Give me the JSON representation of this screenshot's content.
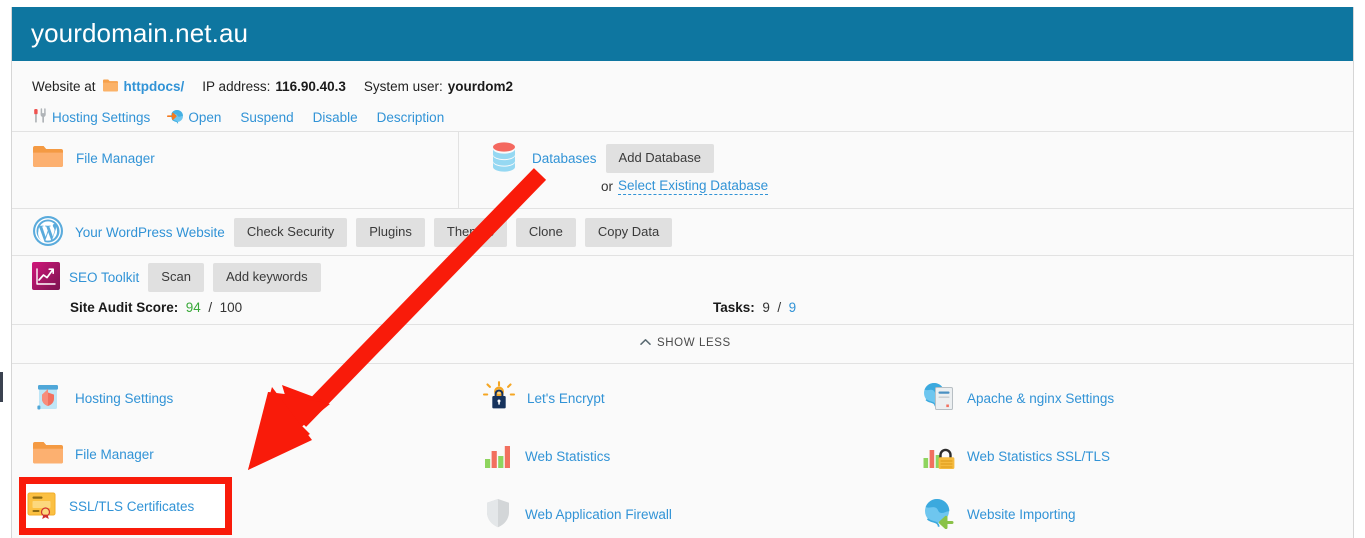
{
  "header": {
    "domain": "yourdomain.net.au",
    "bar_color": "#0e76a0"
  },
  "info": {
    "website_at_label": "Website at",
    "httpdocs_link": "httpdocs/",
    "ip_label": "IP address:",
    "ip_value": "116.90.40.3",
    "system_user_label": "System user:",
    "system_user_value": "yourdom2"
  },
  "actions": [
    {
      "label": "Hosting Settings",
      "icon": "tools-icon"
    },
    {
      "label": "Open",
      "icon": "globe-arrow-icon"
    },
    {
      "label": "Suspend",
      "icon": ""
    },
    {
      "label": "Disable",
      "icon": ""
    },
    {
      "label": "Description",
      "icon": ""
    }
  ],
  "file_manager_row": {
    "label": "File Manager",
    "icon": "folder-icon"
  },
  "databases_row": {
    "label": "Databases",
    "icon": "database-icon",
    "add_button": "Add Database",
    "or_text": "or",
    "select_existing_link": "Select Existing Database"
  },
  "wordpress_row": {
    "label": "Your WordPress Website",
    "icon": "wordpress-icon",
    "buttons": [
      "Check Security",
      "Plugins",
      "Themes",
      "Clone",
      "Copy Data"
    ]
  },
  "seo_row": {
    "label": "SEO Toolkit",
    "icon": "seo-chart-icon",
    "buttons": [
      "Scan",
      "Add keywords"
    ],
    "site_audit_label": "Site Audit Score:",
    "site_audit_score": "94",
    "site_audit_separator": "/",
    "site_audit_total": "100",
    "tasks_label": "Tasks:",
    "tasks_done": "9",
    "tasks_separator": "/",
    "tasks_total": "9"
  },
  "show_less": {
    "label": "SHOW LESS",
    "icon": "chevron-up-icon"
  },
  "services": [
    {
      "label": "Hosting Settings",
      "icon": "hosting-settings-icon",
      "col": 0,
      "rowidx": 0
    },
    {
      "label": "File Manager",
      "icon": "folder-icon",
      "col": 0,
      "rowidx": 1
    },
    {
      "label": "SSL/TLS Certificates",
      "icon": "certificate-icon",
      "col": 0,
      "rowidx": 2
    },
    {
      "label": "Let's Encrypt",
      "icon": "lets-encrypt-icon",
      "col": 1,
      "rowidx": 0
    },
    {
      "label": "Web Statistics",
      "icon": "bar-chart-icon",
      "col": 1,
      "rowidx": 1
    },
    {
      "label": "Web Application Firewall",
      "icon": "shield-icon",
      "col": 1,
      "rowidx": 2
    },
    {
      "label": "Apache & nginx Settings",
      "icon": "server-globe-icon",
      "col": 2,
      "rowidx": 0
    },
    {
      "label": "Web Statistics SSL/TLS",
      "icon": "chart-lock-icon",
      "col": 2,
      "rowidx": 1
    },
    {
      "label": "Website Importing",
      "icon": "globe-import-icon",
      "col": 2,
      "rowidx": 2
    }
  ],
  "annotations": {
    "arrow_color": "#f91b0a",
    "highlight_box_color": "#f91b0a",
    "highlighted_item": "SSL/TLS Certificates"
  },
  "colors": {
    "link": "#3193d6",
    "header_blue": "#0e76a0",
    "button_gray": "#e0e0e0",
    "score_green": "#3aa93a",
    "annotation_red": "#f91b0a"
  }
}
